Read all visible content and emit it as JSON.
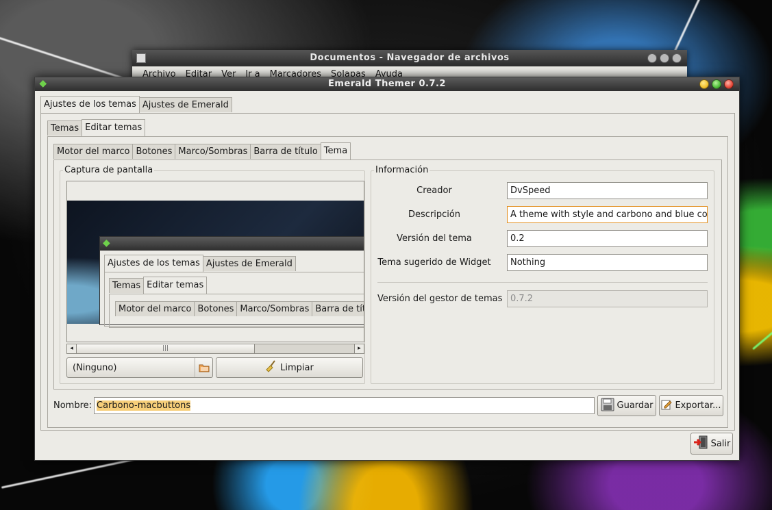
{
  "bg_window": {
    "title": "Documentos - Navegador de archivos",
    "menu": [
      "Archivo",
      "Editar",
      "Ver",
      "Ir a",
      "Marcadores",
      "Solapas",
      "Ayuda"
    ]
  },
  "window": {
    "title": "Emerald Themer 0.7.2",
    "main_tabs": [
      "Ajustes de los temas",
      "Ajustes de Emerald"
    ],
    "sub_tabs": [
      "Temas",
      "Editar temas"
    ],
    "edit_tabs": [
      "Motor del marco",
      "Botones",
      "Marco/Sombras",
      "Barra de título",
      "Tema"
    ]
  },
  "screenshot": {
    "label": "Captura de pantalla",
    "preview_main_tabs": [
      "Ajustes de los temas",
      "Ajustes de Emerald"
    ],
    "preview_sub_tabs": [
      "Temas",
      "Editar temas"
    ],
    "preview_edit_tabs": [
      "Motor del marco",
      "Botones",
      "Marco/Sombras",
      "Barra de títu"
    ],
    "file_chooser": "(Ninguno)",
    "clear_label": "Limpiar"
  },
  "info": {
    "label": "Información",
    "creator_label": "Creador",
    "creator_value": "DvSpeed",
    "desc_label": "Descripción",
    "desc_value": "A theme with style and carbono and blue colo",
    "version_label": "Versión del tema",
    "version_value": "0.2",
    "widget_label": "Tema sugerido de Widget",
    "widget_value": "Nothing",
    "manager_label": "Versión del gestor de temas",
    "manager_value": "0.7.2"
  },
  "bottom": {
    "name_label": "Nombre:",
    "name_value": "Carbono-macbuttons",
    "save_label": "Guardar",
    "export_label": "Exportar...",
    "quit_label": "Salir"
  },
  "colors": {
    "close": "#e84a3a",
    "minimize": "#f2c230",
    "maximize": "#4fbf3a",
    "selection": "#f7cf7a"
  }
}
